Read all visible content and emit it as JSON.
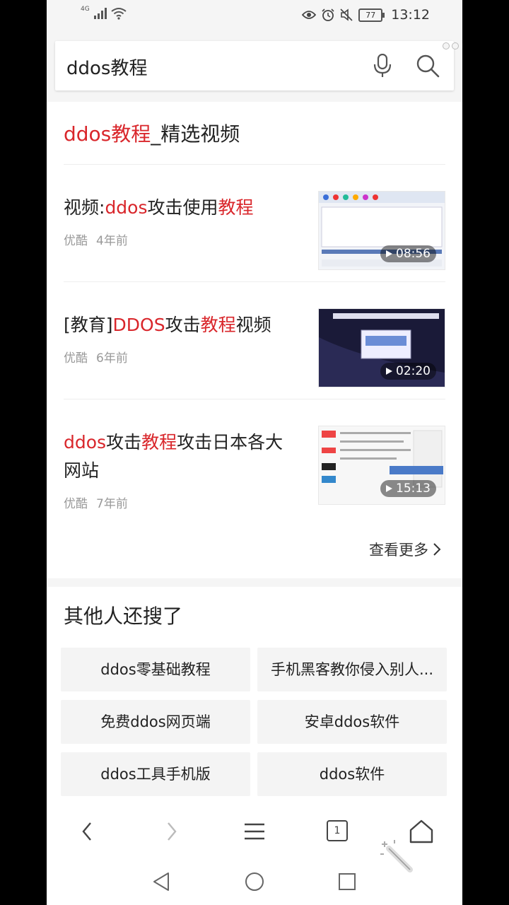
{
  "status_bar": {
    "network": "4G",
    "battery": "77",
    "time": "13:12"
  },
  "search": {
    "query": "ddos教程"
  },
  "video_section": {
    "title_highlight": "ddos教程",
    "title_rest": "_精选视频",
    "videos": [
      {
        "title_parts": [
          {
            "text": "视频:",
            "highlight": false
          },
          {
            "text": "ddos",
            "highlight": true
          },
          {
            "text": "攻击使用",
            "highlight": false
          },
          {
            "text": "教程",
            "highlight": true
          }
        ],
        "source": "优酷",
        "age": "4年前",
        "duration": "08:56"
      },
      {
        "title_parts": [
          {
            "text": "[教育]",
            "highlight": false
          },
          {
            "text": "DDOS",
            "highlight": true
          },
          {
            "text": "攻击",
            "highlight": false
          },
          {
            "text": "教程",
            "highlight": true
          },
          {
            "text": "视频",
            "highlight": false
          }
        ],
        "source": "优酷",
        "age": "6年前",
        "duration": "02:20"
      },
      {
        "title_parts": [
          {
            "text": "ddos",
            "highlight": true
          },
          {
            "text": "攻击",
            "highlight": false
          },
          {
            "text": "教程",
            "highlight": true
          },
          {
            "text": "攻击日本各大网站",
            "highlight": false
          }
        ],
        "source": "优酷",
        "age": "7年前",
        "duration": "15:13"
      }
    ],
    "more_label": "查看更多"
  },
  "related": {
    "title": "其他人还搜了",
    "items": [
      "ddos零基础教程",
      "手机黑客教你侵入别人...",
      "免费ddos网页端",
      "安卓ddos软件",
      "ddos工具手机版",
      "ddos软件"
    ]
  },
  "toolbar": {
    "tabs_count": "1"
  },
  "colors": {
    "highlight": "#d9262b",
    "text": "#222222",
    "meta": "#999999"
  }
}
